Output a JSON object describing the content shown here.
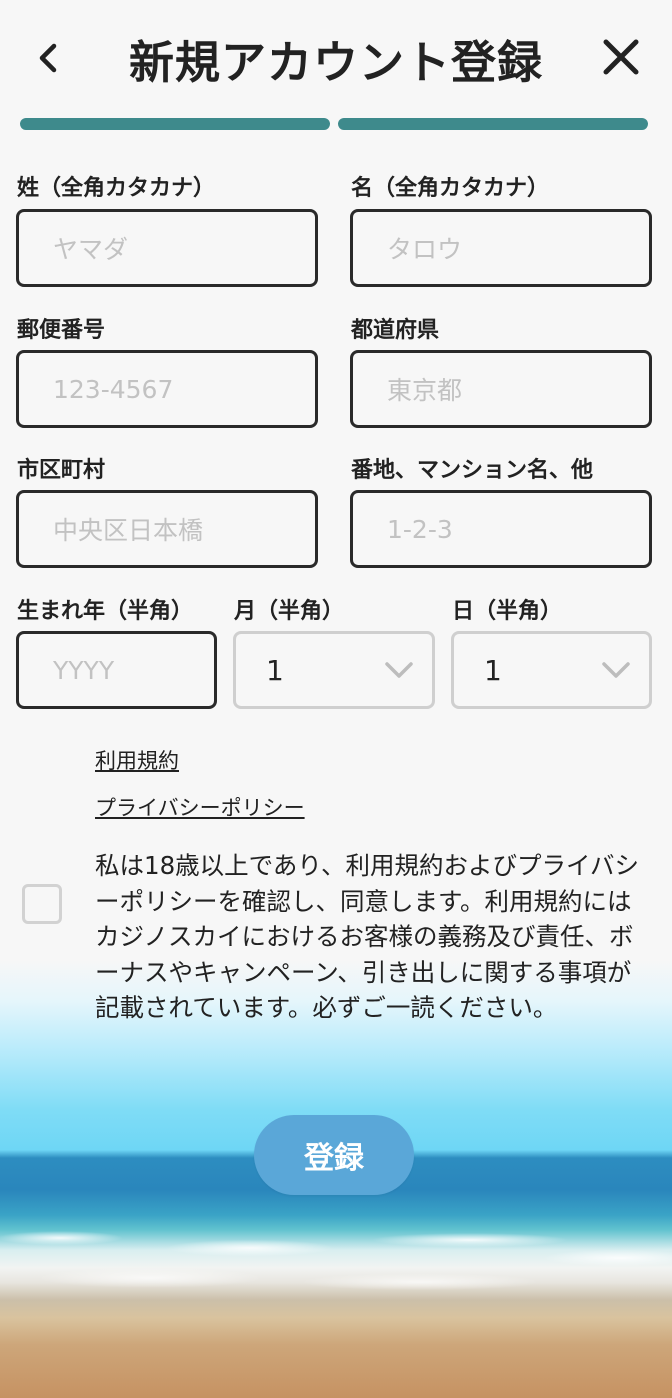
{
  "header": {
    "title": "新規アカウント登録",
    "progress_steps": 2,
    "progress_color": "#3e8a8c"
  },
  "form": {
    "last_name": {
      "label": "姓（全角カタカナ）",
      "placeholder": "ヤマダ"
    },
    "first_name": {
      "label": "名（全角カタカナ）",
      "placeholder": "タロウ"
    },
    "postal_code": {
      "label": "郵便番号",
      "placeholder": "123-4567"
    },
    "prefecture": {
      "label": "都道府県",
      "placeholder": "東京都"
    },
    "city": {
      "label": "市区町村",
      "placeholder": "中央区日本橋"
    },
    "address": {
      "label": "番地、マンション名、他",
      "placeholder": "1-2-3"
    },
    "birth_year": {
      "label": "生まれ年（半角）",
      "placeholder": "YYYY"
    },
    "birth_month": {
      "label": "月（半角）",
      "value": "1"
    },
    "birth_day": {
      "label": "日（半角）",
      "value": "1"
    }
  },
  "links": {
    "terms": "利用規約",
    "privacy": "プライバシーポリシー"
  },
  "consent": {
    "checked": false,
    "text": "私は18歳以上であり、利用規約およびプライバシーポリシーを確認し、同意します。利用規約にはカジノスカイにおけるお客様の義務及び責任、ボーナスやキャンペーン、引き出しに関する事項が記載されています。必ずご一読ください。"
  },
  "submit": {
    "label": "登録",
    "color": "#5aa7d8"
  },
  "icons": {
    "back": "chevron-left-icon",
    "close": "close-icon",
    "dropdown": "chevron-down-icon"
  }
}
